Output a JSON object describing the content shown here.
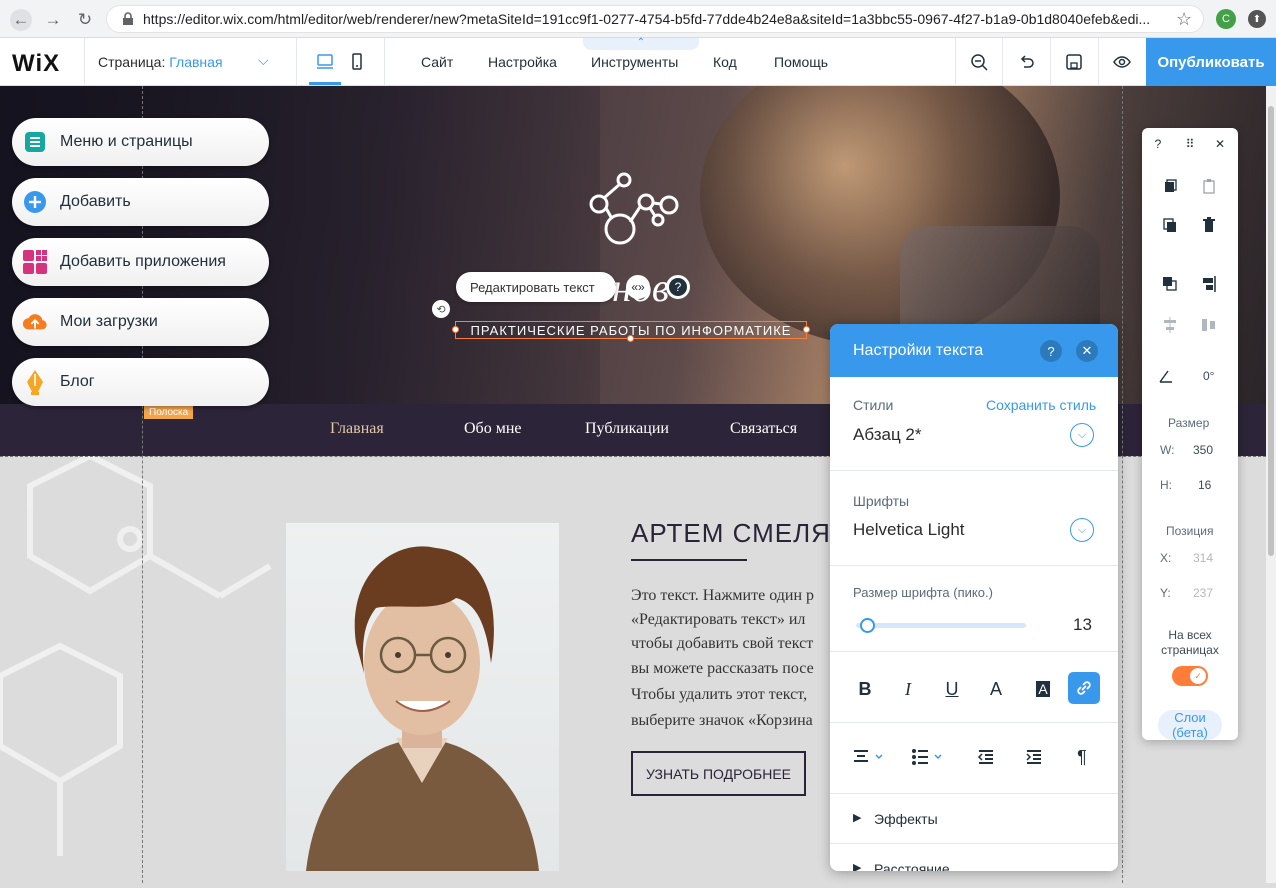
{
  "browser": {
    "url": "https://editor.wix.com/html/editor/web/renderer/new?metaSiteId=191cc9f1-0277-4754-b5fd-77dde4b24e8a&siteId=1a3bbc55-0967-4f27-b1a9-0b1d8040efeb&edi...",
    "avatar_letter": "C"
  },
  "topbar": {
    "logo": "WiX",
    "page_label": "Страница:",
    "page_name": "Главная",
    "menu": [
      "Сайт",
      "Настройка",
      "Инструменты",
      "Код",
      "Помощь"
    ],
    "publish": "Опубликовать",
    "accent": "#3899ec"
  },
  "left_panel": [
    {
      "label": "Меню и страницы",
      "icon": "pages-icon"
    },
    {
      "label": "Добавить",
      "icon": "add-icon"
    },
    {
      "label": "Добавить приложения",
      "icon": "apps-icon"
    },
    {
      "label": "Мои загрузки",
      "icon": "upload-icon"
    },
    {
      "label": "Блог",
      "icon": "blog-icon"
    }
  ],
  "hero": {
    "title_partial": "нов",
    "subtitle": "ПРАКТИЧЕСКИЕ РАБОТЫ ПО ИНФОРМАТИКЕ",
    "edit_text_button": "Редактировать текст",
    "strip_label": "Полоска"
  },
  "site_nav": [
    "Главная",
    "Обо мне",
    "Публикации",
    "Связаться"
  ],
  "content": {
    "heading": "АРТЕМ СМЕЛЯ",
    "paragraph_lines": [
      "Это текст. Нажмите один р",
      "«Редактировать текст» ил",
      "чтобы добавить свой текст",
      "вы можете рассказать посе",
      "Чтобы удалить этот текст,",
      "выберите значок «Корзина"
    ],
    "more_button": "УЗНАТЬ ПОДРОБНЕЕ"
  },
  "text_settings": {
    "title": "Настройки текста",
    "styles_label": "Стили",
    "save_style": "Сохранить стиль",
    "style_value": "Абзац 2*",
    "fonts_label": "Шрифты",
    "font_value": "Helvetica Light",
    "size_label": "Размер шрифта (пико.)",
    "size_value": "13",
    "size_fraction": 0.05,
    "effects": "Эффекты",
    "spacing": "Расстояние"
  },
  "right_toolbar": {
    "rotation": "0°",
    "size_label": "Размер",
    "w_label": "W:",
    "w_value": "350",
    "h_label": "H:",
    "h_value": "16",
    "position_label": "Позиция",
    "x_label": "X:",
    "x_value": "314",
    "y_label": "Y:",
    "y_value": "237",
    "all_pages": "На всех страницах",
    "layers": "Слои (бета)"
  }
}
